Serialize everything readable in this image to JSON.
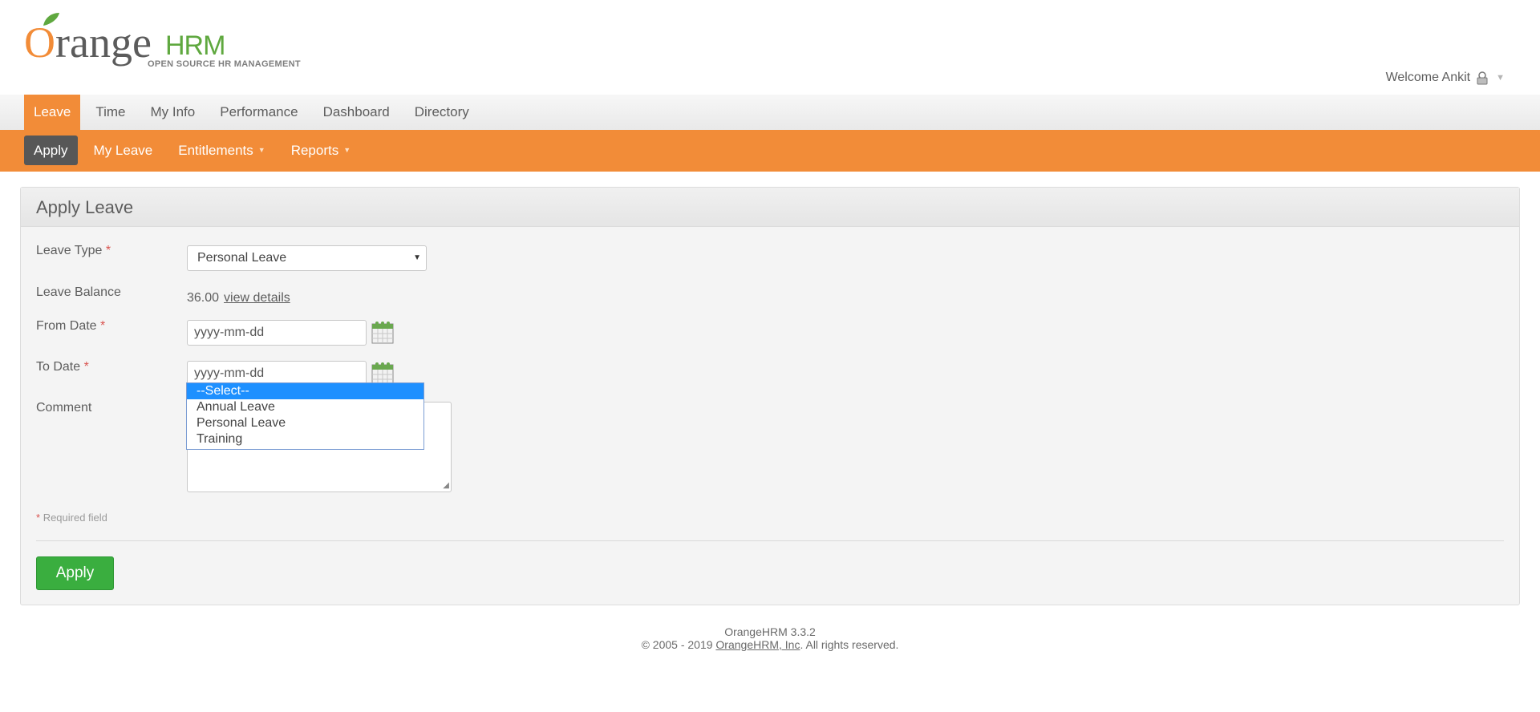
{
  "brand": {
    "logo_word": "range",
    "logo_o": "O",
    "logo_hrm": "HRM",
    "logo_sub": "OPEN SOURCE HR MANAGEMENT",
    "colors": {
      "orange": "#f28c38",
      "green": "#5fa83f"
    }
  },
  "header": {
    "welcome": "Welcome Ankit",
    "user_icon": "user-lock-icon"
  },
  "main_menu": {
    "items": [
      {
        "label": "Leave",
        "active": true
      },
      {
        "label": "Time"
      },
      {
        "label": "My Info"
      },
      {
        "label": "Performance"
      },
      {
        "label": "Dashboard"
      },
      {
        "label": "Directory"
      }
    ]
  },
  "sub_menu": {
    "items": [
      {
        "label": "Apply",
        "active": true
      },
      {
        "label": "My Leave"
      },
      {
        "label": "Entitlements",
        "has_arrow": true
      },
      {
        "label": "Reports",
        "has_arrow": true
      }
    ]
  },
  "form": {
    "title": "Apply Leave",
    "leave_type": {
      "label": "Leave Type",
      "required_mark": "*",
      "value": "Personal Leave"
    },
    "leave_balance": {
      "label": "Leave Balance",
      "value": "36.00",
      "link": "view details"
    },
    "from_date": {
      "label": "From Date",
      "required_mark": "*",
      "value": "yyyy-mm-dd"
    },
    "to_date": {
      "label": "To Date",
      "required_mark": "*",
      "value": "yyyy-mm-dd"
    },
    "comment": {
      "label": "Comment",
      "value": ""
    },
    "required_note_mark": "*",
    "required_note": "Required field",
    "apply_button": "Apply",
    "apply_color": "#3aae3f"
  },
  "dropdown": {
    "options": [
      "--Select--",
      "Annual Leave",
      "Personal Leave",
      "Training"
    ],
    "highlighted_index": 0,
    "highlight_color": "#1e90ff"
  },
  "footer": {
    "version": "OrangeHRM 3.3.2",
    "copyright_prefix": "© 2005 - 2019 ",
    "company_link": "OrangeHRM, Inc",
    "copyright_suffix": ". All rights reserved."
  }
}
